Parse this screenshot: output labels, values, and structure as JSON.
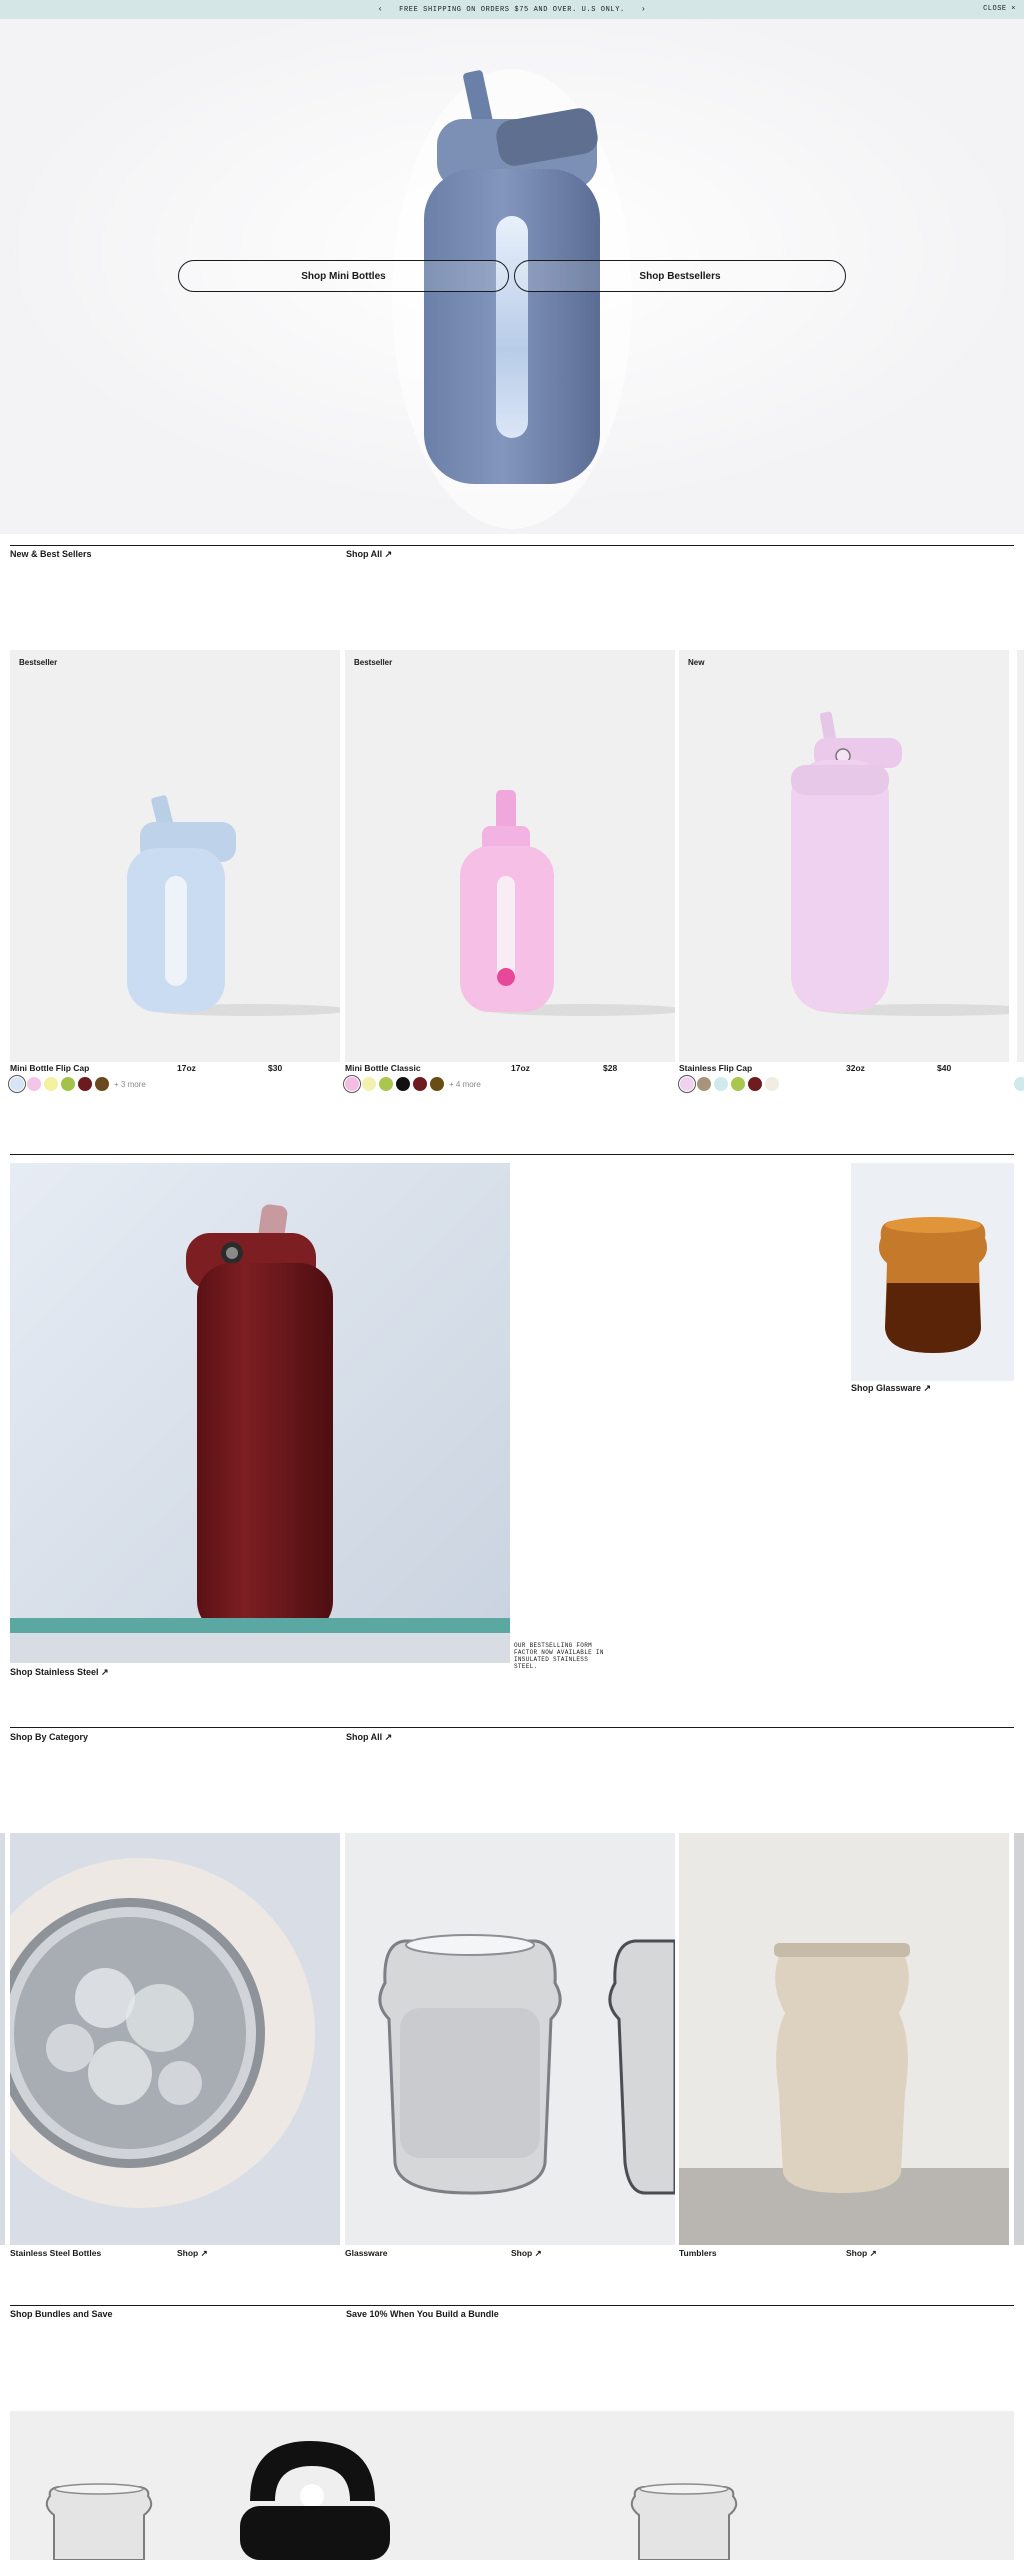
{
  "announcement": {
    "prev": "‹",
    "text": "FREE SHIPPING ON ORDERS $75 AND OVER. U.S ONLY.",
    "next": "›",
    "close": "CLOSE ×"
  },
  "hero": {
    "button_left": "Shop Mini Bottles",
    "button_right": "Shop Bestsellers"
  },
  "new_best": {
    "title": "New & Best Sellers",
    "link": "Shop All ↗"
  },
  "products": [
    {
      "badge": "Bestseller",
      "name": "Mini Bottle Flip Cap",
      "size": "17oz",
      "price": "$30",
      "more": "+ 3 more",
      "swatches": [
        "#d6e6f6",
        "#f3c6e8",
        "#f4f1a0",
        "#a4c24a",
        "#6b1a1e",
        "#6a4a1e"
      ]
    },
    {
      "badge": "Bestseller",
      "name": "Mini Bottle Classic",
      "size": "17oz",
      "price": "$28",
      "more": "+ 4 more",
      "swatches": [
        "#f4bde4",
        "#f3f1b0",
        "#a9c64e",
        "#111111",
        "#6d1d1f",
        "#6a4d14"
      ]
    },
    {
      "badge": "New",
      "name": "Stainless Flip Cap",
      "size": "32oz",
      "price": "$40",
      "more": "",
      "swatches": [
        "#f0d2ef",
        "#a89478",
        "#cfeaed",
        "#a9c64e",
        "#6d1d1f",
        "#f3ece2"
      ]
    }
  ],
  "feature": {
    "shop_stainless": "Shop Stainless Steel ↗",
    "shop_glassware": "Shop Glassware ↗",
    "caption": "OUR BESTSELLING FORM FACTOR NOW AVAILABLE IN INSULATED STAINLESS STEEL."
  },
  "category": {
    "title": "Shop By Category",
    "link": "Shop All ↗",
    "items": [
      {
        "label": "Stainless Steel Bottles",
        "shop": "Shop ↗"
      },
      {
        "label": "Glassware",
        "shop": "Shop ↗"
      },
      {
        "label": "Tumblers",
        "shop": "Shop ↗"
      }
    ]
  },
  "bundles": {
    "title": "Shop Bundles and Save",
    "subtitle": "Save 10% When You Build a Bundle"
  },
  "colors": {
    "announce_bg": "#d4e6e6",
    "rule": "#1a1a1a"
  }
}
